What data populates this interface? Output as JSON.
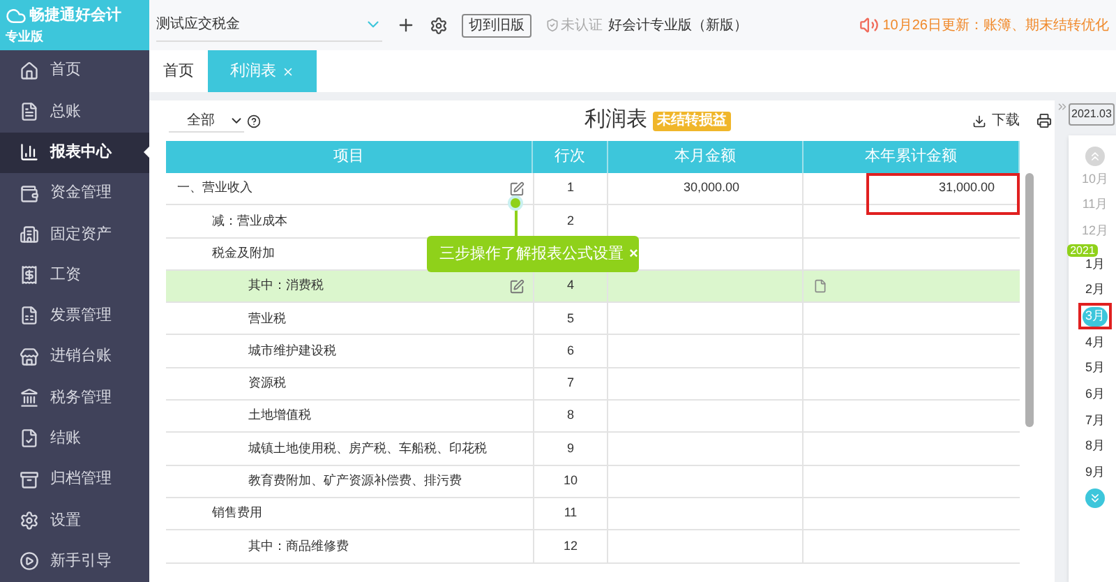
{
  "brand": {
    "name": "畅捷通好会计",
    "edition": "专业版"
  },
  "sidebar": {
    "items": [
      {
        "label": "首页",
        "selected": false
      },
      {
        "label": "总账",
        "selected": false
      },
      {
        "label": "报表中心",
        "selected": true
      },
      {
        "label": "资金管理",
        "selected": false
      },
      {
        "label": "固定资产",
        "selected": false
      },
      {
        "label": "工资",
        "selected": false
      },
      {
        "label": "发票管理",
        "selected": false
      },
      {
        "label": "进销台账",
        "selected": false
      },
      {
        "label": "税务管理",
        "selected": false
      },
      {
        "label": "结账",
        "selected": false
      },
      {
        "label": "归档管理",
        "selected": false
      },
      {
        "label": "设置",
        "selected": false
      },
      {
        "label": "新手引导",
        "selected": false
      }
    ]
  },
  "topbar": {
    "account": "测试应交税金",
    "switch_button": "切到旧版",
    "certification": "未认证",
    "product": "好会计专业版（新版）",
    "notice": "10月26日更新：账簿、期末结转优化"
  },
  "tabs": [
    {
      "label": "首页",
      "selected": false,
      "closable": false
    },
    {
      "label": "利润表",
      "selected": true,
      "closable": true
    }
  ],
  "report": {
    "filter": "全部",
    "title": "利润表",
    "status_badge": "未结转损益",
    "download": "下载",
    "columns": [
      "项目",
      "行次",
      "本月金额",
      "本年累计金额"
    ],
    "rows": [
      {
        "label": "一、营业收入",
        "line": "1",
        "month": "30,000.00",
        "year": "31,000.00",
        "selected": false,
        "editable": true,
        "note": false,
        "flagged": true,
        "children": [
          {
            "label": "减：营业成本",
            "line": "2",
            "selected": false,
            "editable": false,
            "note": false,
            "flagged": false
          },
          {
            "label": "税金及附加",
            "selected": false,
            "editable": false,
            "note": false,
            "flagged": false,
            "children": [
              {
                "label": "其中：消费税",
                "line": "4",
                "selected": true,
                "editable": true,
                "note": true,
                "flagged": false
              },
              {
                "label": "营业税",
                "line": "5",
                "selected": false,
                "editable": false,
                "note": false,
                "flagged": false
              },
              {
                "label": "城市维护建设税",
                "line": "6",
                "selected": false,
                "editable": false,
                "note": false,
                "flagged": false
              },
              {
                "label": "资源税",
                "line": "7",
                "selected": false,
                "editable": false,
                "note": false,
                "flagged": false
              },
              {
                "label": "土地增值税",
                "line": "8",
                "selected": false,
                "editable": false,
                "note": false,
                "flagged": false
              },
              {
                "label": "城镇土地使用税、房产税、车船税、印花税",
                "line": "9",
                "selected": false,
                "editable": false,
                "note": false,
                "flagged": false
              },
              {
                "label": "教育费附加、矿产资源补偿费、排污费",
                "line": "10",
                "selected": false,
                "editable": false,
                "note": false,
                "flagged": false
              }
            ]
          },
          {
            "label": "销售费用",
            "line": "11",
            "selected": false,
            "editable": false,
            "note": false,
            "flagged": false,
            "children": [
              {
                "label": "其中：商品维修费",
                "line": "12",
                "selected": false,
                "editable": false,
                "note": false,
                "flagged": false
              }
            ]
          }
        ]
      }
    ]
  },
  "guide_tip": {
    "text": "三步操作了解报表公式设置",
    "close": "×"
  },
  "period_panel": {
    "period": "2021.03",
    "year_badge": "2021",
    "months": [
      {
        "label": "10月",
        "selected": false,
        "enabled": false
      },
      {
        "label": "11月",
        "selected": false,
        "enabled": false
      },
      {
        "label": "12月",
        "selected": false,
        "enabled": false
      },
      {
        "label": "1月",
        "selected": false,
        "enabled": true,
        "year_start": true
      },
      {
        "label": "2月",
        "selected": false,
        "enabled": true
      },
      {
        "label": "3月",
        "selected": true,
        "enabled": true
      },
      {
        "label": "4月",
        "selected": false,
        "enabled": true
      },
      {
        "label": "5月",
        "selected": false,
        "enabled": true
      },
      {
        "label": "6月",
        "selected": false,
        "enabled": true
      },
      {
        "label": "7月",
        "selected": false,
        "enabled": true
      },
      {
        "label": "8月",
        "selected": false,
        "enabled": true
      },
      {
        "label": "9月",
        "selected": false,
        "enabled": true
      }
    ]
  }
}
